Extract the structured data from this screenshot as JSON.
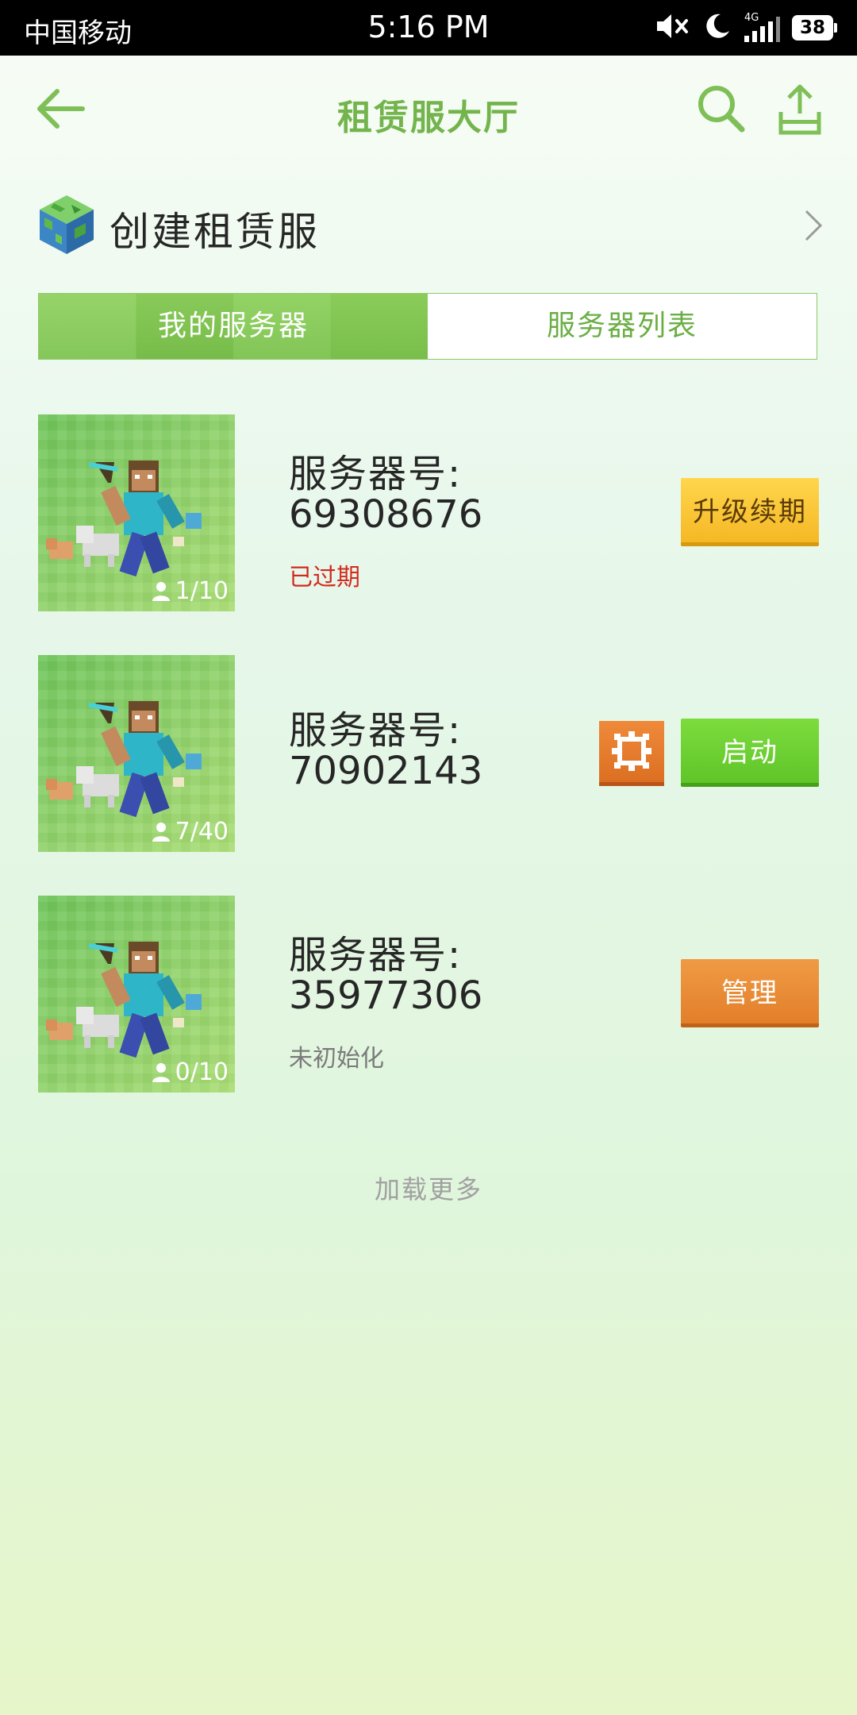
{
  "status_bar": {
    "carrier": "中国移动",
    "time": "5:16 PM",
    "network": "4G",
    "battery": "38"
  },
  "header": {
    "title": "租赁服大厅"
  },
  "create": {
    "label": "创建租赁服"
  },
  "tabs": [
    {
      "label": "我的服务器",
      "active": true
    },
    {
      "label": "服务器列表",
      "active": false
    }
  ],
  "servers": [
    {
      "label": "服务器号:",
      "number": "69308676",
      "players": "1/10",
      "status": "已过期",
      "action": "升级续期"
    },
    {
      "label": "服务器号:",
      "number": "70902143",
      "players": "7/40",
      "status": "",
      "action": "启动"
    },
    {
      "label": "服务器号:",
      "number": "35977306",
      "players": "0/10",
      "status": "未初始化",
      "action": "管理"
    }
  ],
  "load_more": "加载更多",
  "colors": {
    "accent_green": "#73b44c",
    "upgrade_yellow": "#f5b825",
    "start_green": "#5fc529",
    "manage_orange": "#e27f2a",
    "expired_red": "#d12b1e"
  },
  "icons": {
    "back": "back-arrow-icon",
    "search": "search-icon",
    "share": "share-icon",
    "create": "world-cube-icon",
    "chevron": "chevron-right-icon",
    "players": "person-icon",
    "settings": "settings-gear-icon"
  }
}
